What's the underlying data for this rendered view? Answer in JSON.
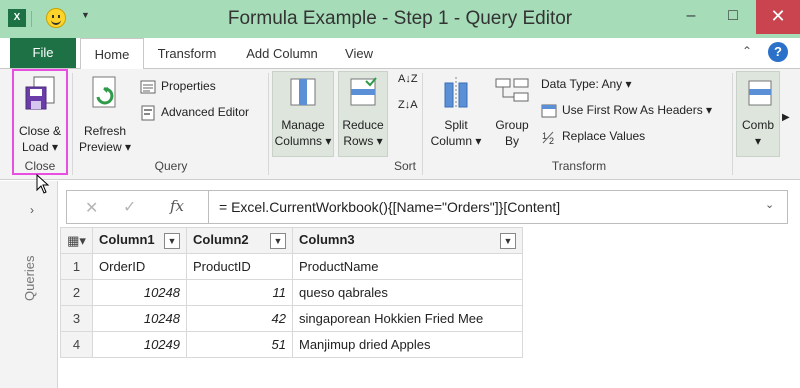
{
  "window": {
    "title": "Formula Example - Step 1 - Query Editor",
    "app_icon": "X",
    "minimize": "–",
    "maximize": "□",
    "close": "✕"
  },
  "tabs": {
    "file": "File",
    "items": [
      "Home",
      "Transform",
      "Add Column",
      "View"
    ],
    "active": "Home"
  },
  "ribbon": {
    "close_group": {
      "label": "Close",
      "close_load_line1": "Close &",
      "close_load_line2": "Load ▾"
    },
    "query_group": {
      "label": "Query",
      "refresh_line1": "Refresh",
      "refresh_line2": "Preview ▾",
      "properties": "Properties",
      "advanced_editor": "Advanced Editor"
    },
    "manage_columns_line1": "Manage",
    "manage_columns_line2": "Columns ▾",
    "reduce_rows_line1": "Reduce",
    "reduce_rows_line2": "Rows ▾",
    "sort_group": {
      "label": "Sort",
      "asc": "A↓Z",
      "desc": "Z↓A"
    },
    "transform_group": {
      "label": "Transform",
      "split_line1": "Split",
      "split_line2": "Column ▾",
      "group_line1": "Group",
      "group_line2": "By",
      "data_type": "Data Type: Any ▾",
      "use_first_row": "Use First Row As Headers ▾",
      "replace_values": "Replace Values"
    },
    "combine_line1": "Comb",
    "combine_line2": "▾",
    "scroll_arrow": "▶"
  },
  "left_pane": {
    "label": "Queries",
    "expand": "›"
  },
  "formula_bar": {
    "cancel": "✕",
    "commit": "✓",
    "fx": "fx",
    "formula": "= Excel.CurrentWorkbook(){[Name=\"Orders\"]}[Content]",
    "expand": "⌄"
  },
  "grid": {
    "columns": [
      "Column1",
      "Column2",
      "Column3"
    ],
    "rows": [
      {
        "n": "1",
        "c1": "OrderID",
        "c2": "ProductID",
        "c3": "ProductName"
      },
      {
        "n": "2",
        "c1": "10248",
        "c2": "11",
        "c3": "queso qabrales"
      },
      {
        "n": "3",
        "c1": "10248",
        "c2": "42",
        "c3": "singaporean Hokkien Fried Mee"
      },
      {
        "n": "4",
        "c1": "10249",
        "c2": "51",
        "c3": "Manjimup dried Apples"
      }
    ]
  }
}
